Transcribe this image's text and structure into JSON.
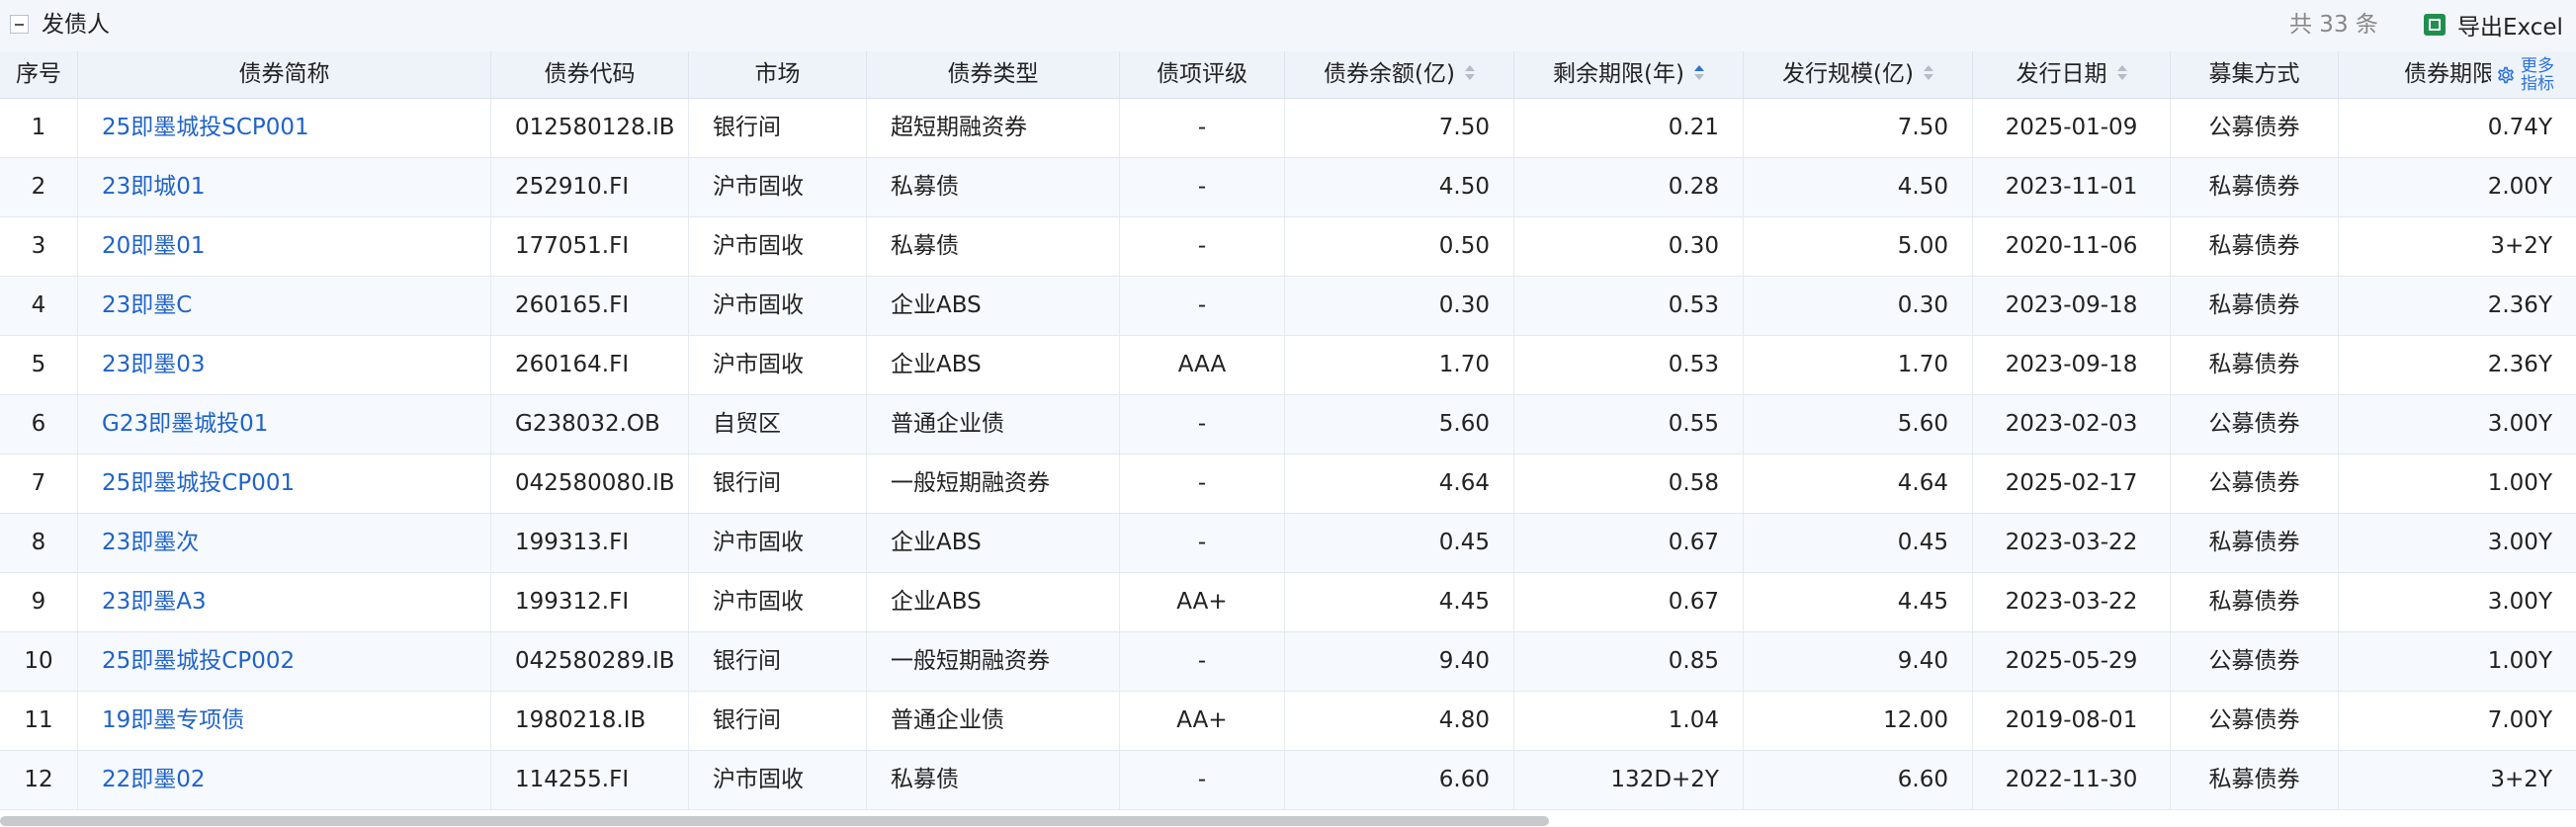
{
  "section": {
    "title": "发债人",
    "total": "共 33 条",
    "export_label": "导出Excel"
  },
  "more_indicators": {
    "label_line1": "更多",
    "label_line2": "指标"
  },
  "columns": [
    {
      "key": "index",
      "label": "序号",
      "sortable": false
    },
    {
      "key": "name",
      "label": "债券简称",
      "sortable": false
    },
    {
      "key": "code",
      "label": "债券代码",
      "sortable": false
    },
    {
      "key": "market",
      "label": "市场",
      "sortable": false
    },
    {
      "key": "type",
      "label": "债券类型",
      "sortable": false
    },
    {
      "key": "rating",
      "label": "债项评级",
      "sortable": false
    },
    {
      "key": "balance",
      "label": "债券余额(亿)",
      "sortable": true
    },
    {
      "key": "remaining",
      "label": "剩余期限(年)",
      "sortable": true,
      "active": "asc"
    },
    {
      "key": "issue_size",
      "label": "发行规模(亿)",
      "sortable": true
    },
    {
      "key": "issue_date",
      "label": "发行日期",
      "sortable": true
    },
    {
      "key": "raise_method",
      "label": "募集方式",
      "sortable": false
    },
    {
      "key": "term",
      "label": "债券期限",
      "sortable": false
    }
  ],
  "rows": [
    {
      "index": "1",
      "name": "25即墨城投SCP001",
      "code": "012580128.IB",
      "market": "银行间",
      "type": "超短期融资券",
      "rating": "-",
      "balance": "7.50",
      "remaining": "0.21",
      "issue_size": "7.50",
      "issue_date": "2025-01-09",
      "raise_method": "公募债券",
      "term": "0.74Y"
    },
    {
      "index": "2",
      "name": "23即城01",
      "code": "252910.FI",
      "market": "沪市固收",
      "type": "私募债",
      "rating": "-",
      "balance": "4.50",
      "remaining": "0.28",
      "issue_size": "4.50",
      "issue_date": "2023-11-01",
      "raise_method": "私募债券",
      "term": "2.00Y"
    },
    {
      "index": "3",
      "name": "20即墨01",
      "code": "177051.FI",
      "market": "沪市固收",
      "type": "私募债",
      "rating": "-",
      "balance": "0.50",
      "remaining": "0.30",
      "issue_size": "5.00",
      "issue_date": "2020-11-06",
      "raise_method": "私募债券",
      "term": "3+2Y"
    },
    {
      "index": "4",
      "name": "23即墨C",
      "code": "260165.FI",
      "market": "沪市固收",
      "type": "企业ABS",
      "rating": "-",
      "balance": "0.30",
      "remaining": "0.53",
      "issue_size": "0.30",
      "issue_date": "2023-09-18",
      "raise_method": "私募债券",
      "term": "2.36Y"
    },
    {
      "index": "5",
      "name": "23即墨03",
      "code": "260164.FI",
      "market": "沪市固收",
      "type": "企业ABS",
      "rating": "AAA",
      "balance": "1.70",
      "remaining": "0.53",
      "issue_size": "1.70",
      "issue_date": "2023-09-18",
      "raise_method": "私募债券",
      "term": "2.36Y"
    },
    {
      "index": "6",
      "name": "G23即墨城投01",
      "code": "G238032.OB",
      "market": "自贸区",
      "type": "普通企业债",
      "rating": "-",
      "balance": "5.60",
      "remaining": "0.55",
      "issue_size": "5.60",
      "issue_date": "2023-02-03",
      "raise_method": "公募债券",
      "term": "3.00Y"
    },
    {
      "index": "7",
      "name": "25即墨城投CP001",
      "code": "042580080.IB",
      "market": "银行间",
      "type": "一般短期融资券",
      "rating": "-",
      "balance": "4.64",
      "remaining": "0.58",
      "issue_size": "4.64",
      "issue_date": "2025-02-17",
      "raise_method": "公募债券",
      "term": "1.00Y"
    },
    {
      "index": "8",
      "name": "23即墨次",
      "code": "199313.FI",
      "market": "沪市固收",
      "type": "企业ABS",
      "rating": "-",
      "balance": "0.45",
      "remaining": "0.67",
      "issue_size": "0.45",
      "issue_date": "2023-03-22",
      "raise_method": "私募债券",
      "term": "3.00Y"
    },
    {
      "index": "9",
      "name": "23即墨A3",
      "code": "199312.FI",
      "market": "沪市固收",
      "type": "企业ABS",
      "rating": "AA+",
      "balance": "4.45",
      "remaining": "0.67",
      "issue_size": "4.45",
      "issue_date": "2023-03-22",
      "raise_method": "私募债券",
      "term": "3.00Y"
    },
    {
      "index": "10",
      "name": "25即墨城投CP002",
      "code": "042580289.IB",
      "market": "银行间",
      "type": "一般短期融资券",
      "rating": "-",
      "balance": "9.40",
      "remaining": "0.85",
      "issue_size": "9.40",
      "issue_date": "2025-05-29",
      "raise_method": "公募债券",
      "term": "1.00Y"
    },
    {
      "index": "11",
      "name": "19即墨专项债",
      "code": "1980218.IB",
      "market": "银行间",
      "type": "普通企业债",
      "rating": "AA+",
      "balance": "4.80",
      "remaining": "1.04",
      "issue_size": "12.00",
      "issue_date": "2019-08-01",
      "raise_method": "公募债券",
      "term": "7.00Y"
    },
    {
      "index": "12",
      "name": "22即墨02",
      "code": "114255.FI",
      "market": "沪市固收",
      "type": "私募债",
      "rating": "-",
      "balance": "6.60",
      "remaining": "132D+2Y",
      "issue_size": "6.60",
      "issue_date": "2022-11-30",
      "raise_method": "私募债券",
      "term": "3+2Y"
    }
  ],
  "colors": {
    "link": "#1f63c9",
    "accent": "#2a72d8",
    "header_bg": "#eef3fa",
    "alt_row_bg": "#f6f9fd",
    "excel_green": "#1f8f4e"
  }
}
